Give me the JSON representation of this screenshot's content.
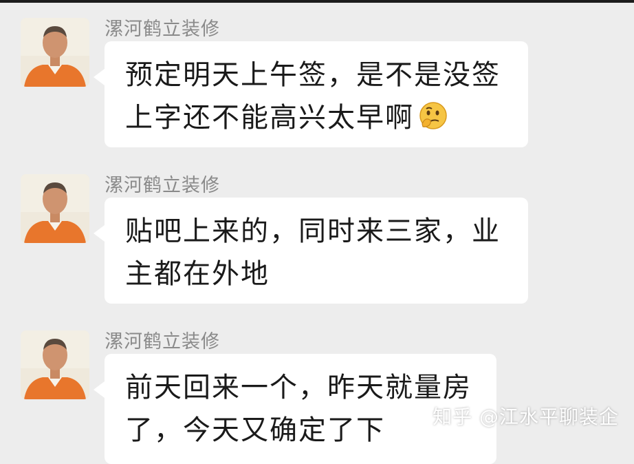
{
  "messages": [
    {
      "sender": "漯河鹤立装修",
      "lines": [
        "预定明天上午签，是不是没签",
        "上字还不能高兴太早啊"
      ],
      "emoji": "thinking-face-icon"
    },
    {
      "sender": "漯河鹤立装修",
      "lines": [
        "贴吧上来的，同时来三家，业",
        "主都在外地"
      ]
    },
    {
      "sender": "漯河鹤立装修",
      "lines": [
        "前天回来一个，昨天就量房",
        "了，今天又确定了下"
      ]
    }
  ],
  "watermark": "知乎 @江水平聊装企",
  "colors": {
    "background": "#ededed",
    "bubble": "#ffffff",
    "sender": "#8a8a8a",
    "text": "#1a1a1a",
    "shirt": "#e8762c"
  }
}
